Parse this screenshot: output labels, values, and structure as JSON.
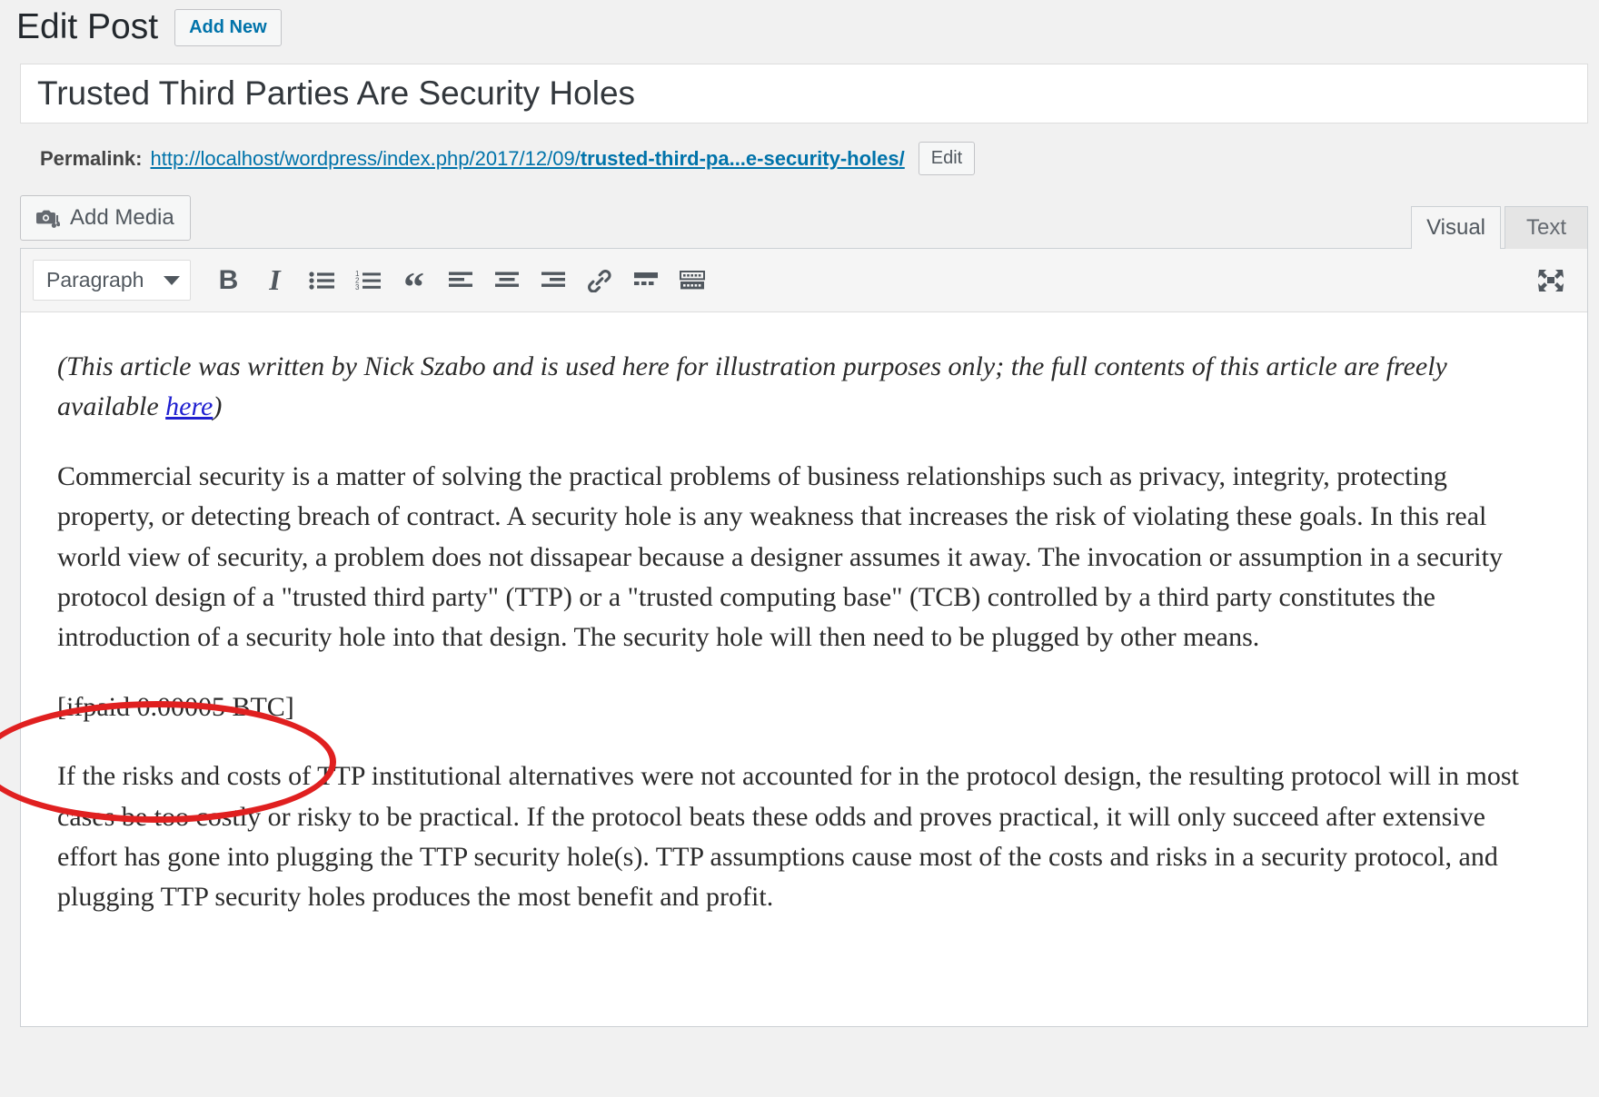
{
  "header": {
    "page_title": "Edit Post",
    "add_new_label": "Add New"
  },
  "post": {
    "title": "Trusted Third Parties Are Security Holes"
  },
  "permalink": {
    "label": "Permalink:",
    "base_url": "http://localhost/wordpress/index.php/2017/12/09/",
    "slug": "trusted-third-pa...e-security-holes/",
    "edit_label": "Edit"
  },
  "media": {
    "add_media_label": "Add Media"
  },
  "editor_tabs": {
    "visual": "Visual",
    "text": "Text",
    "active": "Visual"
  },
  "toolbar": {
    "style_select_value": "Paragraph",
    "buttons": [
      {
        "name": "bold",
        "label": "B",
        "title": "Bold"
      },
      {
        "name": "italic",
        "label": "I",
        "title": "Italic"
      },
      {
        "name": "bulleted-list",
        "label": "",
        "title": "Bulleted list"
      },
      {
        "name": "numbered-list",
        "label": "",
        "title": "Numbered list"
      },
      {
        "name": "blockquote",
        "label": "“",
        "title": "Blockquote"
      },
      {
        "name": "align-left",
        "label": "",
        "title": "Align left"
      },
      {
        "name": "align-center",
        "label": "",
        "title": "Align center"
      },
      {
        "name": "align-right",
        "label": "",
        "title": "Align right"
      },
      {
        "name": "insert-link",
        "label": "",
        "title": "Insert/edit link"
      },
      {
        "name": "read-more",
        "label": "",
        "title": "Insert Read More tag"
      },
      {
        "name": "toolbar-toggle",
        "label": "",
        "title": "Toolbar Toggle"
      }
    ],
    "fullscreen_title": "Distraction-free writing mode"
  },
  "content": {
    "intro_before_link": "(This article was written by Nick Szabo and is used here for illustration purposes only; the full contents of this article are freely available ",
    "intro_link": "here",
    "intro_after_link": ")",
    "paragraph_1": "Commercial security is a matter of solving the practical problems of business relationships such as privacy, integrity, protecting property, or detecting breach of contract. A security hole is any weakness that increases the risk of violating these goals. In this real world view of security, a problem does not dissapear because a designer assumes it away. The invocation or assumption in a security protocol design of a \"trusted third party\" (TTP) or a \"trusted computing base\" (TCB) controlled by a third party constitutes the introduction of a security hole into that design. The security hole will then need to be plugged by other means.",
    "shortcode": "[ifpaid 0.00005 BTC]",
    "paragraph_2": "If the risks and costs of TTP institutional alternatives were not accounted for in the protocol design, the resulting protocol will in most cases be too costly or risky to be practical. If the protocol beats these odds and proves practical, it will only succeed after extensive effort has gone into plugging the TTP security hole(s). TTP assumptions cause most of the costs and risks in a security protocol, and plugging TTP security holes produces the most benefit and profit."
  },
  "annotation": {
    "target": "[ifpaid 0.00005 BTC]",
    "shape": "ellipse",
    "color": "#e02020"
  },
  "colors": {
    "page_background": "#f1f1f1",
    "link_blue": "#0073aa",
    "content_link_blue": "#2020d0",
    "annotation_red": "#e02020",
    "border_gray": "#ccd0d4"
  }
}
